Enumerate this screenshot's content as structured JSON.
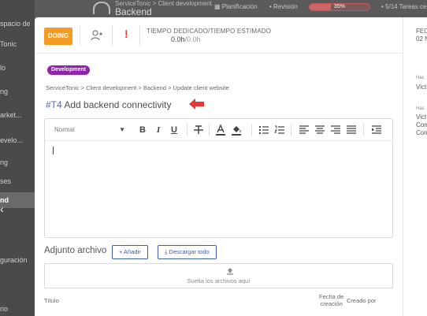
{
  "background": {
    "sidebar": {
      "items": [
        "spacio de",
        "Tonic",
        "lo",
        "ng",
        "arket...",
        "evelo...",
        "ng",
        "ses",
        "nd",
        "guración",
        "rio"
      ],
      "active_index": 8,
      "collapse_icon": "chevron-left-icon"
    },
    "topbar": {
      "breadcrumb": "ServiceTonic > Client development",
      "project": "Backend",
      "planning_label": "Planificación",
      "review_label": "Revisión",
      "progress_text": "35%",
      "progress_value": 0.35,
      "tasks_text": "5/14 Tareas cerradas"
    }
  },
  "modal": {
    "status_label": "DOING",
    "status_color": "#f59a23",
    "assign_icon": "add-person-icon",
    "priority_icon": "exclamation-icon",
    "priority_color": "#e53935",
    "time": {
      "label": "TIEMPO DEDICADO/TIEMPO ESTIMADO",
      "spent": "0.0h",
      "estimated": "/0.0h"
    },
    "right_panel": {
      "date_label": "FECH",
      "date_value": "02 N",
      "field1_label": "Hac",
      "field1_value": "Vict",
      "field2_label": "Hac",
      "field2_values": [
        "Vict",
        "Con",
        "Con"
      ]
    },
    "tag": "Development",
    "tag_color": "#8e24aa",
    "breadcrumb": "ServiceTonic > Client development > Backend > Update client website",
    "task_number": "#T4",
    "task_title": "Add backend connectivity",
    "editor": {
      "format_value": "Normal",
      "toolbar_icons": [
        "bold-icon",
        "italic-icon",
        "underline-icon",
        "strikethrough-icon",
        "text-color-icon",
        "fill-color-icon",
        "bullet-list-icon",
        "numbered-list-icon",
        "align-left-icon",
        "align-center-icon",
        "align-right-icon",
        "align-justify-icon",
        "indent-icon"
      ],
      "bold_glyph": "B",
      "italic_glyph": "I",
      "underline_glyph": "U"
    },
    "attachments": {
      "title": "Adjunto archivo",
      "add_button": "+ Añadir",
      "download_button": "Descargar todo",
      "dropzone_text": "Suelta los archivos aquí",
      "columns": {
        "title": "Título",
        "created_date_line1": "Fecha de",
        "created_date_line2": "creación",
        "created_by": "Creado por"
      }
    }
  }
}
